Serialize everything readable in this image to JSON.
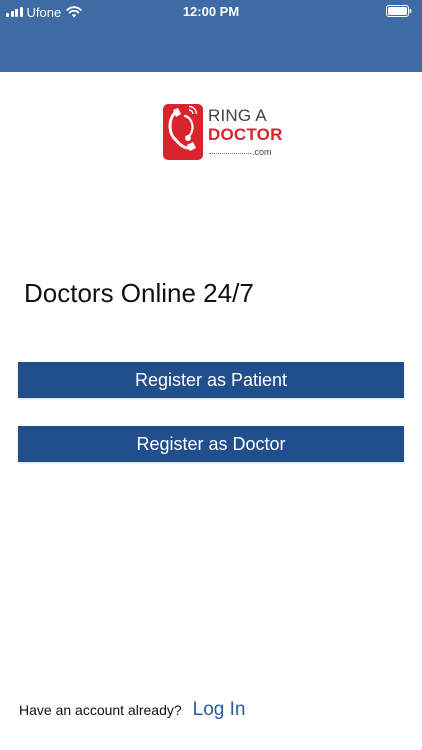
{
  "status_bar": {
    "carrier": "Ufone",
    "time": "12:00 PM",
    "signal_icon": "signal-bars-icon",
    "wifi_icon": "wifi-icon",
    "battery_icon": "battery-icon"
  },
  "logo": {
    "line1": "RING A",
    "line2": "DOCTOR",
    "suffix": ".com",
    "icon": "stethoscope-phone-icon"
  },
  "headline": "Doctors Online 24/7",
  "buttons": {
    "register_patient": "Register as Patient",
    "register_doctor": "Register as Doctor"
  },
  "footer": {
    "prompt": "Have an account already?",
    "login_link": "Log In"
  },
  "colors": {
    "header_bg": "#3f6ba4",
    "button_bg": "#214f8d",
    "link": "#2a5aa0",
    "brand_red": "#d9232d"
  }
}
